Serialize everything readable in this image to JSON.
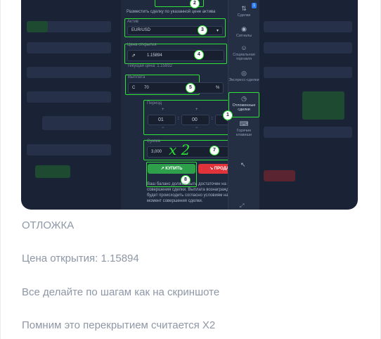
{
  "screenshot": {
    "header_hint": "Разместить сделку по указанной цене актива",
    "asset": {
      "label": "Актив",
      "value": "EUR/USD"
    },
    "open_price": {
      "label": "Цена открытия",
      "value": "1.15894",
      "current": "Текущая цена: 1.15932"
    },
    "payout": {
      "label": "Выплата",
      "prefix": "С",
      "value": "70",
      "suffix": "%"
    },
    "period": {
      "label": "Период",
      "hours": "01",
      "minutes": "00",
      "seconds": "00",
      "plus": "+",
      "minus": "−",
      "sep": ":"
    },
    "amount": {
      "label": "Сумма",
      "value": "3,000",
      "currency": "$",
      "handwritten": "x 2"
    },
    "buy_label": "КУПИТЬ",
    "sell_label": "ПРОДАТЬ",
    "disclaimer": "Ваш баланс должен быть достаточен на момент совершения сделки. Выплата вознаграждения будет происходить согласно условиям на момент совершения сделки.",
    "sidebar": [
      {
        "icon": "⇅",
        "label": "Сделки"
      },
      {
        "icon": "◉",
        "label": "Сигналы"
      },
      {
        "icon": "☺",
        "label": "Социальная торговля"
      },
      {
        "icon": "◎",
        "label": "Экспресс-сделки"
      },
      {
        "icon": "◷",
        "label": "Отложенные сделки"
      },
      {
        "icon": "⌨",
        "label": "Горячие клавиши"
      }
    ],
    "badge_count": "1",
    "markers": [
      "1",
      "2",
      "3",
      "4",
      "5",
      "6",
      "7",
      "8"
    ],
    "colors": {
      "highlight": "#2fe236",
      "buy": "#2e9f4a",
      "sell": "#e0333a"
    }
  },
  "captions": {
    "title": "ОТЛОЖКА",
    "price_line": "Цена открытия: 1.15894",
    "steps_line": "Все делайте по шагам как на скриншоте",
    "remember_line": "Помним это перекрытием считается Х2"
  }
}
